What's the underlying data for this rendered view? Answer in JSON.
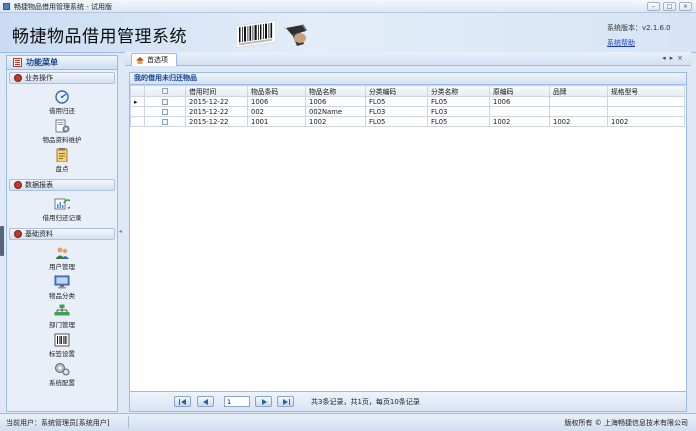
{
  "window": {
    "title": "畅捷物品借用管理系统 - 试用版",
    "controls": [
      "–",
      "□",
      "×"
    ]
  },
  "header": {
    "logo_text": "畅捷物品借用管理系统",
    "version": "系统版本：v2.1.6.0",
    "help": "系统帮助"
  },
  "sidebar": {
    "title": "功能菜单",
    "sections": [
      {
        "label": "业务操作",
        "color": "#c0392b",
        "items": [
          {
            "label": "借用归还",
            "icon": "gauge-icon"
          },
          {
            "label": "物品资料维护",
            "icon": "document-gear-icon"
          },
          {
            "label": "盘点",
            "icon": "clipboard-icon"
          }
        ]
      },
      {
        "label": "数据报表",
        "color": "#c0392b",
        "items": [
          {
            "label": "借用归还记录",
            "icon": "chart-refresh-icon"
          }
        ]
      },
      {
        "label": "基础资料",
        "color": "#c0392b",
        "items": [
          {
            "label": "用户管理",
            "icon": "users-icon"
          },
          {
            "label": "物品分类",
            "icon": "monitor-icon"
          },
          {
            "label": "部门管理",
            "icon": "org-chart-icon"
          },
          {
            "label": "标签设置",
            "icon": "barcode-icon"
          },
          {
            "label": "系统配置",
            "icon": "gears-icon"
          }
        ]
      }
    ]
  },
  "tabs": [
    {
      "label": "首选项",
      "icon": "home-icon"
    }
  ],
  "tab_nav": {
    "prev": "◂",
    "next": "▸",
    "close": "×"
  },
  "grid": {
    "title": "我的借用未归还物品",
    "columns": [
      "",
      "",
      "借用时间",
      "物品条码",
      "物品名称",
      "分类编码",
      "分类名称",
      "原编码",
      "品牌",
      "规格型号"
    ],
    "rows": [
      {
        "indicator": "▸",
        "date": "2015-12-22",
        "barcode": "1006",
        "name": "1006",
        "cat_code": "FL05",
        "cat_name": "FL05",
        "orig_code": "1006",
        "brand": "",
        "model": ""
      },
      {
        "indicator": "",
        "date": "2015-12-22",
        "barcode": "002",
        "name": "002Name",
        "cat_code": "FL03",
        "cat_name": "FL03",
        "orig_code": "",
        "brand": "",
        "model": ""
      },
      {
        "indicator": "",
        "date": "2015-12-22",
        "barcode": "1001",
        "name": "1002",
        "cat_code": "FL05",
        "cat_name": "FL05",
        "orig_code": "1002",
        "brand": "1002",
        "model": "1002"
      }
    ]
  },
  "pager": {
    "page": "1",
    "info": "共3条记录，共1页，每页10条记录"
  },
  "status": {
    "user": "当前用户：系统管理员[系统用户]",
    "copyright": "版权所有 © 上海畅捷信息技术有限公司"
  },
  "colors": {
    "accent": "#99bbe8",
    "header_bg": "#d6e4f5",
    "link": "#1f3fbf"
  }
}
